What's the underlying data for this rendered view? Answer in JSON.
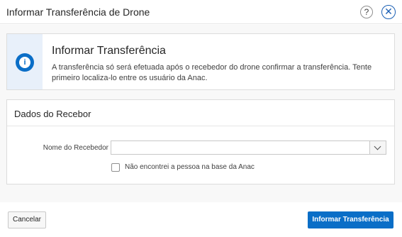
{
  "dialog": {
    "title": "Informar Transferência de Drone",
    "help_glyph": "?",
    "close_glyph": "✕"
  },
  "alert": {
    "icon": "info-icon",
    "icon_glyph": "i",
    "title": "Informar Transferência",
    "text": "A transferência só será efetuada após o recebedor do drone confirmar a transferência. Tente primeiro localiza-lo entre os usuário da Anac."
  },
  "region": {
    "title": "Dados do Recebor",
    "field": {
      "label": "Nome do Recebedor",
      "value": ""
    },
    "checkbox": {
      "label": "Não encontrei a pessoa na base da Anac",
      "checked": false
    }
  },
  "footer": {
    "cancel_label": "Cancelar",
    "submit_label": "Informar Transferência"
  },
  "colors": {
    "accent": "#0a6ec7",
    "close": "#1a5fb4",
    "alert_bg": "#e8f0fa"
  }
}
